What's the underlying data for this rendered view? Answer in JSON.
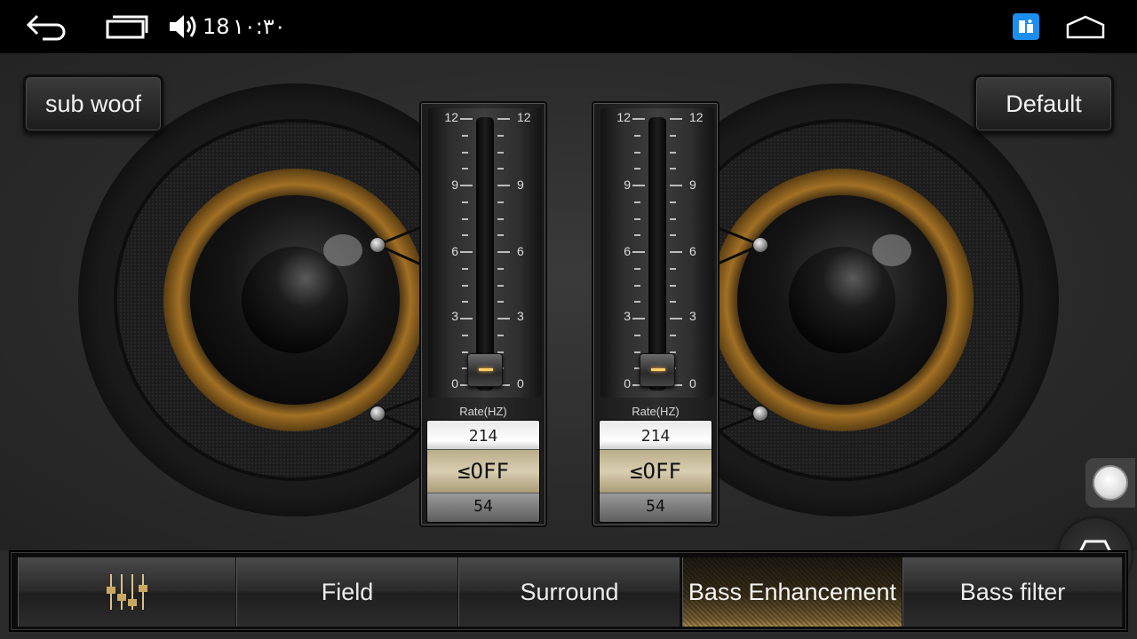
{
  "status_bar": {
    "back_icon": "back-arrow-icon",
    "recents_icon": "recent-apps-icon",
    "volume_icon": "volume-icon",
    "volume_level": "18",
    "time": "١٠:٣٠",
    "app_icon": "app-badge-icon",
    "home_icon": "home-icon"
  },
  "buttons": {
    "subwoof_label": "sub woof",
    "default_label": "Default"
  },
  "sliders": [
    {
      "scale_labels": [
        "12",
        "9",
        "6",
        "3",
        "0"
      ],
      "value": 0,
      "rate_label": "Rate(HZ)",
      "drum_prev": "214",
      "drum_selected": "≤OFF",
      "drum_next": "54"
    },
    {
      "scale_labels": [
        "12",
        "9",
        "6",
        "3",
        "0"
      ],
      "value": 0,
      "rate_label": "Rate(HZ)",
      "drum_prev": "214",
      "drum_selected": "≤OFF",
      "drum_next": "54"
    }
  ],
  "tabs": [
    {
      "label": "",
      "icon": "equalizer-icon"
    },
    {
      "label": "Field"
    },
    {
      "label": "Surround"
    },
    {
      "label": "Bass Enhancement",
      "active": true
    },
    {
      "label": "Bass filter"
    }
  ],
  "floating": {
    "assist_icon": "assistive-touch-icon",
    "car_icon": "car-rotate-icon"
  },
  "colors": {
    "accent_gold": "#b07a25",
    "knob_light": "#ffcf6a",
    "app_badge": "#1c8ef0"
  }
}
